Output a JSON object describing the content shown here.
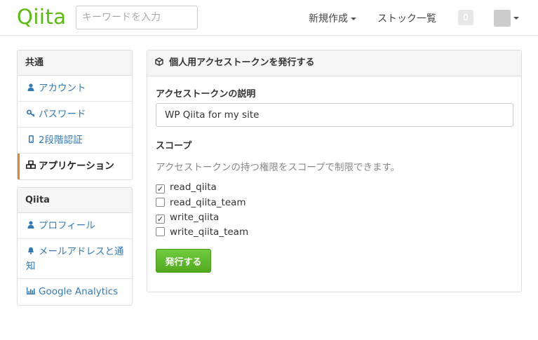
{
  "header": {
    "logo": "Qiita",
    "search_placeholder": "キーワードを入力",
    "new_label": "新規作成",
    "stock_label": "ストック一覧",
    "notification_count": "0"
  },
  "sidebar": {
    "common": {
      "title": "共通",
      "items": [
        {
          "label": "アカウント",
          "icon": "user-icon"
        },
        {
          "label": "パスワード",
          "icon": "key-icon"
        },
        {
          "label": "2段階認証",
          "icon": "mobile-icon"
        },
        {
          "label": "アプリケーション",
          "icon": "cubes-icon",
          "active": true
        }
      ]
    },
    "qiita": {
      "title": "Qiita",
      "items": [
        {
          "label": "プロフィール",
          "icon": "user-icon"
        },
        {
          "label": "メールアドレスと通知",
          "icon": "bell-icon"
        },
        {
          "label": "Google Analytics",
          "icon": "bar-chart-icon"
        }
      ]
    }
  },
  "main": {
    "title": "個人用アクセストークンを発行する",
    "description_label": "アクセストークンの説明",
    "description_value": "WP Qiita for my site",
    "scope_label": "スコープ",
    "scope_help": "アクセストークンの持つ権限をスコープで制限できます。",
    "scopes": [
      {
        "name": "read_qiita",
        "checked": true
      },
      {
        "name": "read_qiita_team",
        "checked": false
      },
      {
        "name": "write_qiita",
        "checked": true
      },
      {
        "name": "write_qiita_team",
        "checked": false
      }
    ],
    "submit_label": "発行する"
  },
  "colors": {
    "brand": "#59bb0c",
    "link": "#337ab7",
    "active_border": "#e4852f",
    "button": "#5cb85c"
  }
}
